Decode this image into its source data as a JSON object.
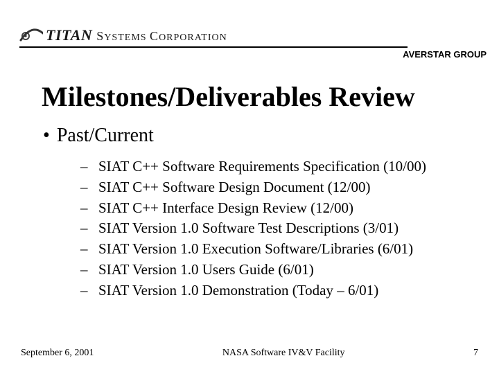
{
  "header": {
    "logo_bold": "TITAN",
    "logo_light_1": "S",
    "logo_light_rest": "YSTEMS",
    "logo_corp_1": "C",
    "logo_corp_rest": "ORPORATION",
    "group": "AVERSTAR GROUP"
  },
  "title": "Milestones/Deliverables Review",
  "section": {
    "bullet": "•",
    "label": "Past/Current"
  },
  "items": [
    "SIAT C++ Software Requirements Specification (10/00)",
    "SIAT C++ Software Design Document (12/00)",
    "SIAT C++ Interface Design Review (12/00)",
    "SIAT Version 1.0 Software Test Descriptions (3/01)",
    "SIAT Version 1.0 Execution Software/Libraries (6/01)",
    "SIAT Version 1.0 Users Guide (6/01)",
    "SIAT Version 1.0 Demonstration (Today – 6/01)"
  ],
  "dash": "–",
  "footer": {
    "date": "September 6, 2001",
    "center": "NASA Software IV&V Facility",
    "page": "7"
  }
}
